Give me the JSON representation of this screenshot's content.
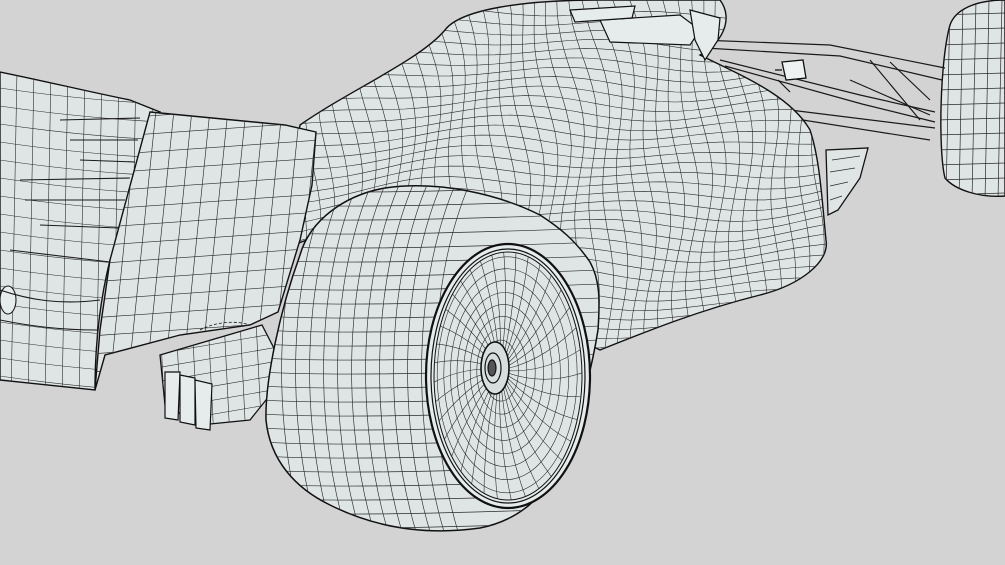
{
  "scene": {
    "subject": "race-car-wireframe-render",
    "colors": {
      "background": "#d3d3d3",
      "surface": "#dfe5e5",
      "surface_shadow": "#cfd6d6",
      "line": "#2a2a2a",
      "edge": "#111111"
    }
  }
}
